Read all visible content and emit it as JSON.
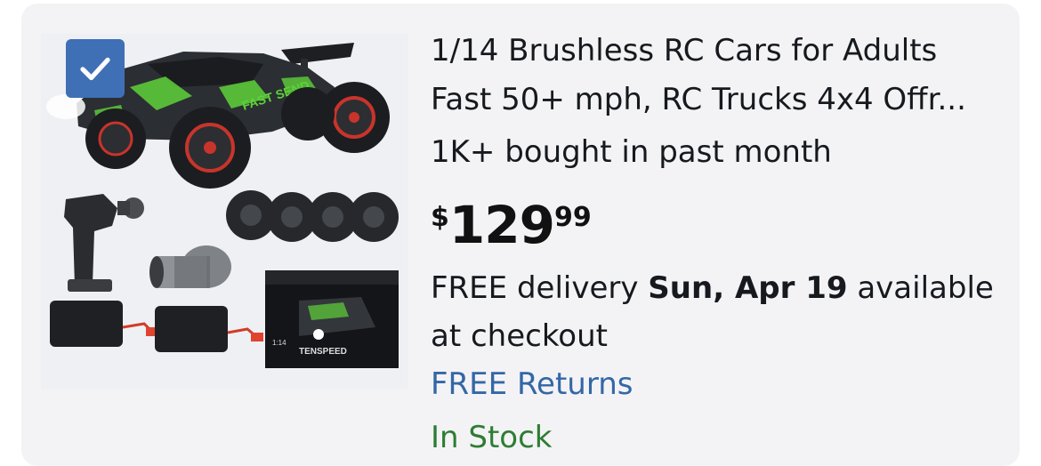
{
  "product": {
    "selected": true,
    "title_line1": "1/14 Brushless RC Cars for Adults",
    "title_line2": "Fast 50+ mph, RC Trucks 4x4 Offr...",
    "bought_text": "1K+ bought in past month",
    "price": {
      "symbol": "$",
      "whole": "129",
      "cents": "99"
    },
    "delivery": {
      "prefix": "FREE delivery ",
      "date": "Sun, Apr 19",
      "suffix": " available",
      "line2": "at checkout"
    },
    "returns_link": "FREE Returns",
    "stock_status": "In Stock",
    "box_brand": "TENSPEED",
    "box_scale": "1:14",
    "car_decal": "FAST SEND"
  },
  "colors": {
    "card_background": "#f3f3f6",
    "checkbox": "#3f70b6",
    "link": "#3467a5",
    "in_stock": "#2e7d32",
    "car_accent": "#5fd13a"
  }
}
